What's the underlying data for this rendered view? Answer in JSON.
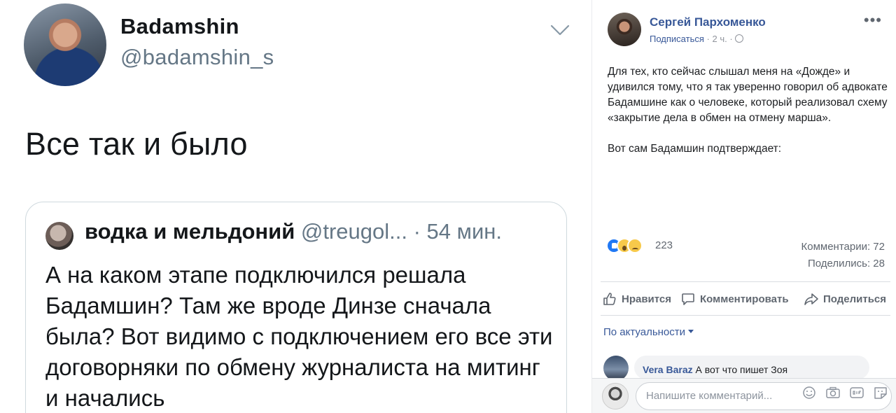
{
  "tweet": {
    "author_name": "Badamshin",
    "author_handle": "@badamshin_s",
    "text": "Все так и было",
    "quoted": {
      "author_name": "водка и мельдоний",
      "meta": "@treugol... · 54 мин.",
      "text": "А на каком этапе подключился решала Бадамшин? Там же вроде Динзе сначала была?  Вот видимо с подключением его все эти договорняки по обмену журналиста на митинг и начались"
    }
  },
  "fb_post": {
    "author_name": "Сергей Пархоменко",
    "follow_label": "Подписаться",
    "time": "2 ч.",
    "more_label": "•••",
    "paragraphs": [
      "Для тех, кто сейчас слышал меня на «Дожде» и удивился тому, что я так уверенно говорил об адвокате Бадамшине как о человеке, который реализовал схему «закрытие дела в обмен на отмену марша».",
      "Вот сам Бадамшин подтверждает:"
    ],
    "reactions": {
      "types": [
        "like",
        "wow",
        "sad"
      ],
      "count": "223"
    },
    "comments_count": "Комментарии: 72",
    "shares_count": "Поделились: 28",
    "actions": {
      "like": "Нравится",
      "comment": "Комментировать",
      "share": "Поделиться"
    },
    "sort_label": "По актуальности",
    "comment": {
      "author": "Vera Baraz",
      "text": "А вот что пишет Зоя"
    },
    "composer_placeholder": "Напишите комментарий..."
  }
}
